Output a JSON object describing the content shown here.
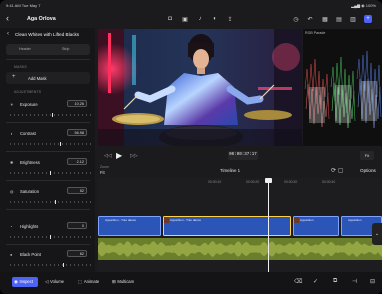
{
  "status_bar": {
    "time": "9:41 AM  Tue May 7",
    "indicators": "▂▄▆ ◉ 100%"
  },
  "topbar": {
    "back_glyph": "‹",
    "project_name": "Aga Orlova",
    "tools": [
      "cam-icon",
      "photo-icon",
      "mic-icon",
      "voiceover-icon",
      "share-icon",
      "clock-icon",
      "undo-icon",
      "grid-icon",
      "media-icon",
      "titles-icon",
      "plus-icon"
    ]
  },
  "inspector": {
    "clip_title": "Clean Whites with Lifted Blacks",
    "tabs": [
      "Header",
      "Strip"
    ],
    "masks_section": "MASKS",
    "add_mask_label": "Add Mask",
    "adjustments_section": "ADJUSTMENTS",
    "params": [
      {
        "label": "Exposure",
        "value": "10.26",
        "level": 0.52
      },
      {
        "label": "Contrast",
        "value": "56.98",
        "level": 0.62
      },
      {
        "label": "Brightness",
        "value": "2.12",
        "level": 0.5
      },
      {
        "label": "Saturation",
        "value": "52",
        "level": 0.56
      },
      {
        "label": "Highlights",
        "value": "0",
        "level": 0.5
      },
      {
        "label": "Black Point",
        "value": "82",
        "level": 0.66
      }
    ]
  },
  "scopes": {
    "label": "RGB Parade"
  },
  "transport": {
    "timecode": "00:00:37:17",
    "zoom": "Fit"
  },
  "timeline": {
    "zoom_label": "Zoom",
    "zoom_value": "Fit",
    "name": "Timeline 1",
    "options_label": "Options",
    "ruler": [
      "00:00:10",
      "00:00:20",
      "00:00:30",
      "00:00:40"
    ],
    "clips": [
      {
        "name": "Apparition - Tutu dance"
      },
      {
        "name": "Apparition - Tutu dance"
      },
      {
        "name": "Apparition"
      },
      {
        "name": "Apparition"
      }
    ]
  },
  "bottombar": {
    "buttons": [
      {
        "label": "Inspect",
        "icon": "◉"
      },
      {
        "label": "Volume",
        "icon": "◁"
      },
      {
        "label": "Animate",
        "icon": "⬚"
      },
      {
        "label": "Multicam",
        "icon": "⊞"
      }
    ]
  },
  "colors": {
    "accent": "#4d63f5",
    "clip_blue": "#2b56b8",
    "audio_green": "#6b7e2b"
  }
}
